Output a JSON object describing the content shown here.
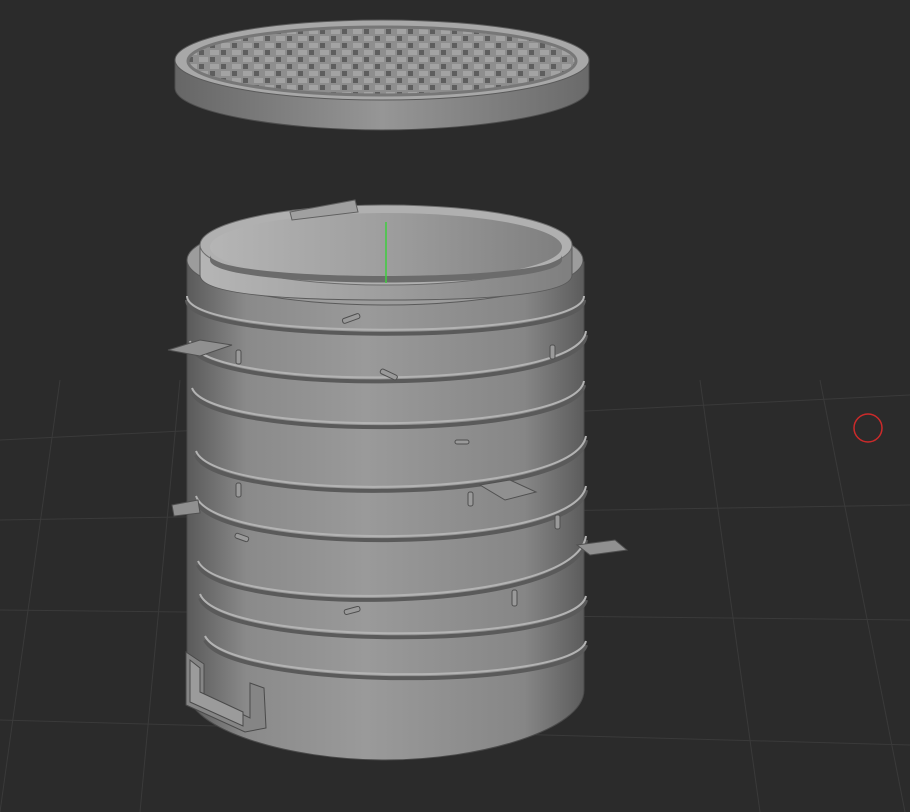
{
  "viewport": {
    "background": "#2b2b2b",
    "grid_color": "#3a3a3a"
  },
  "scene_objects": [
    {
      "name": "steamer-lid",
      "kind": "lid",
      "pattern": "woven-lattice",
      "color": "#8a8a8a"
    },
    {
      "name": "steamer-stack",
      "kind": "cylinder-stack",
      "ring_count": 9,
      "color": "#8d8d8d"
    },
    {
      "name": "handle",
      "kind": "loop-handle",
      "color": "#858585"
    }
  ],
  "gizmo": {
    "axis_color": "#3ecf3e",
    "pivot_marker": "pivot-circle-icon",
    "pivot_color": "#cc2a2a"
  }
}
